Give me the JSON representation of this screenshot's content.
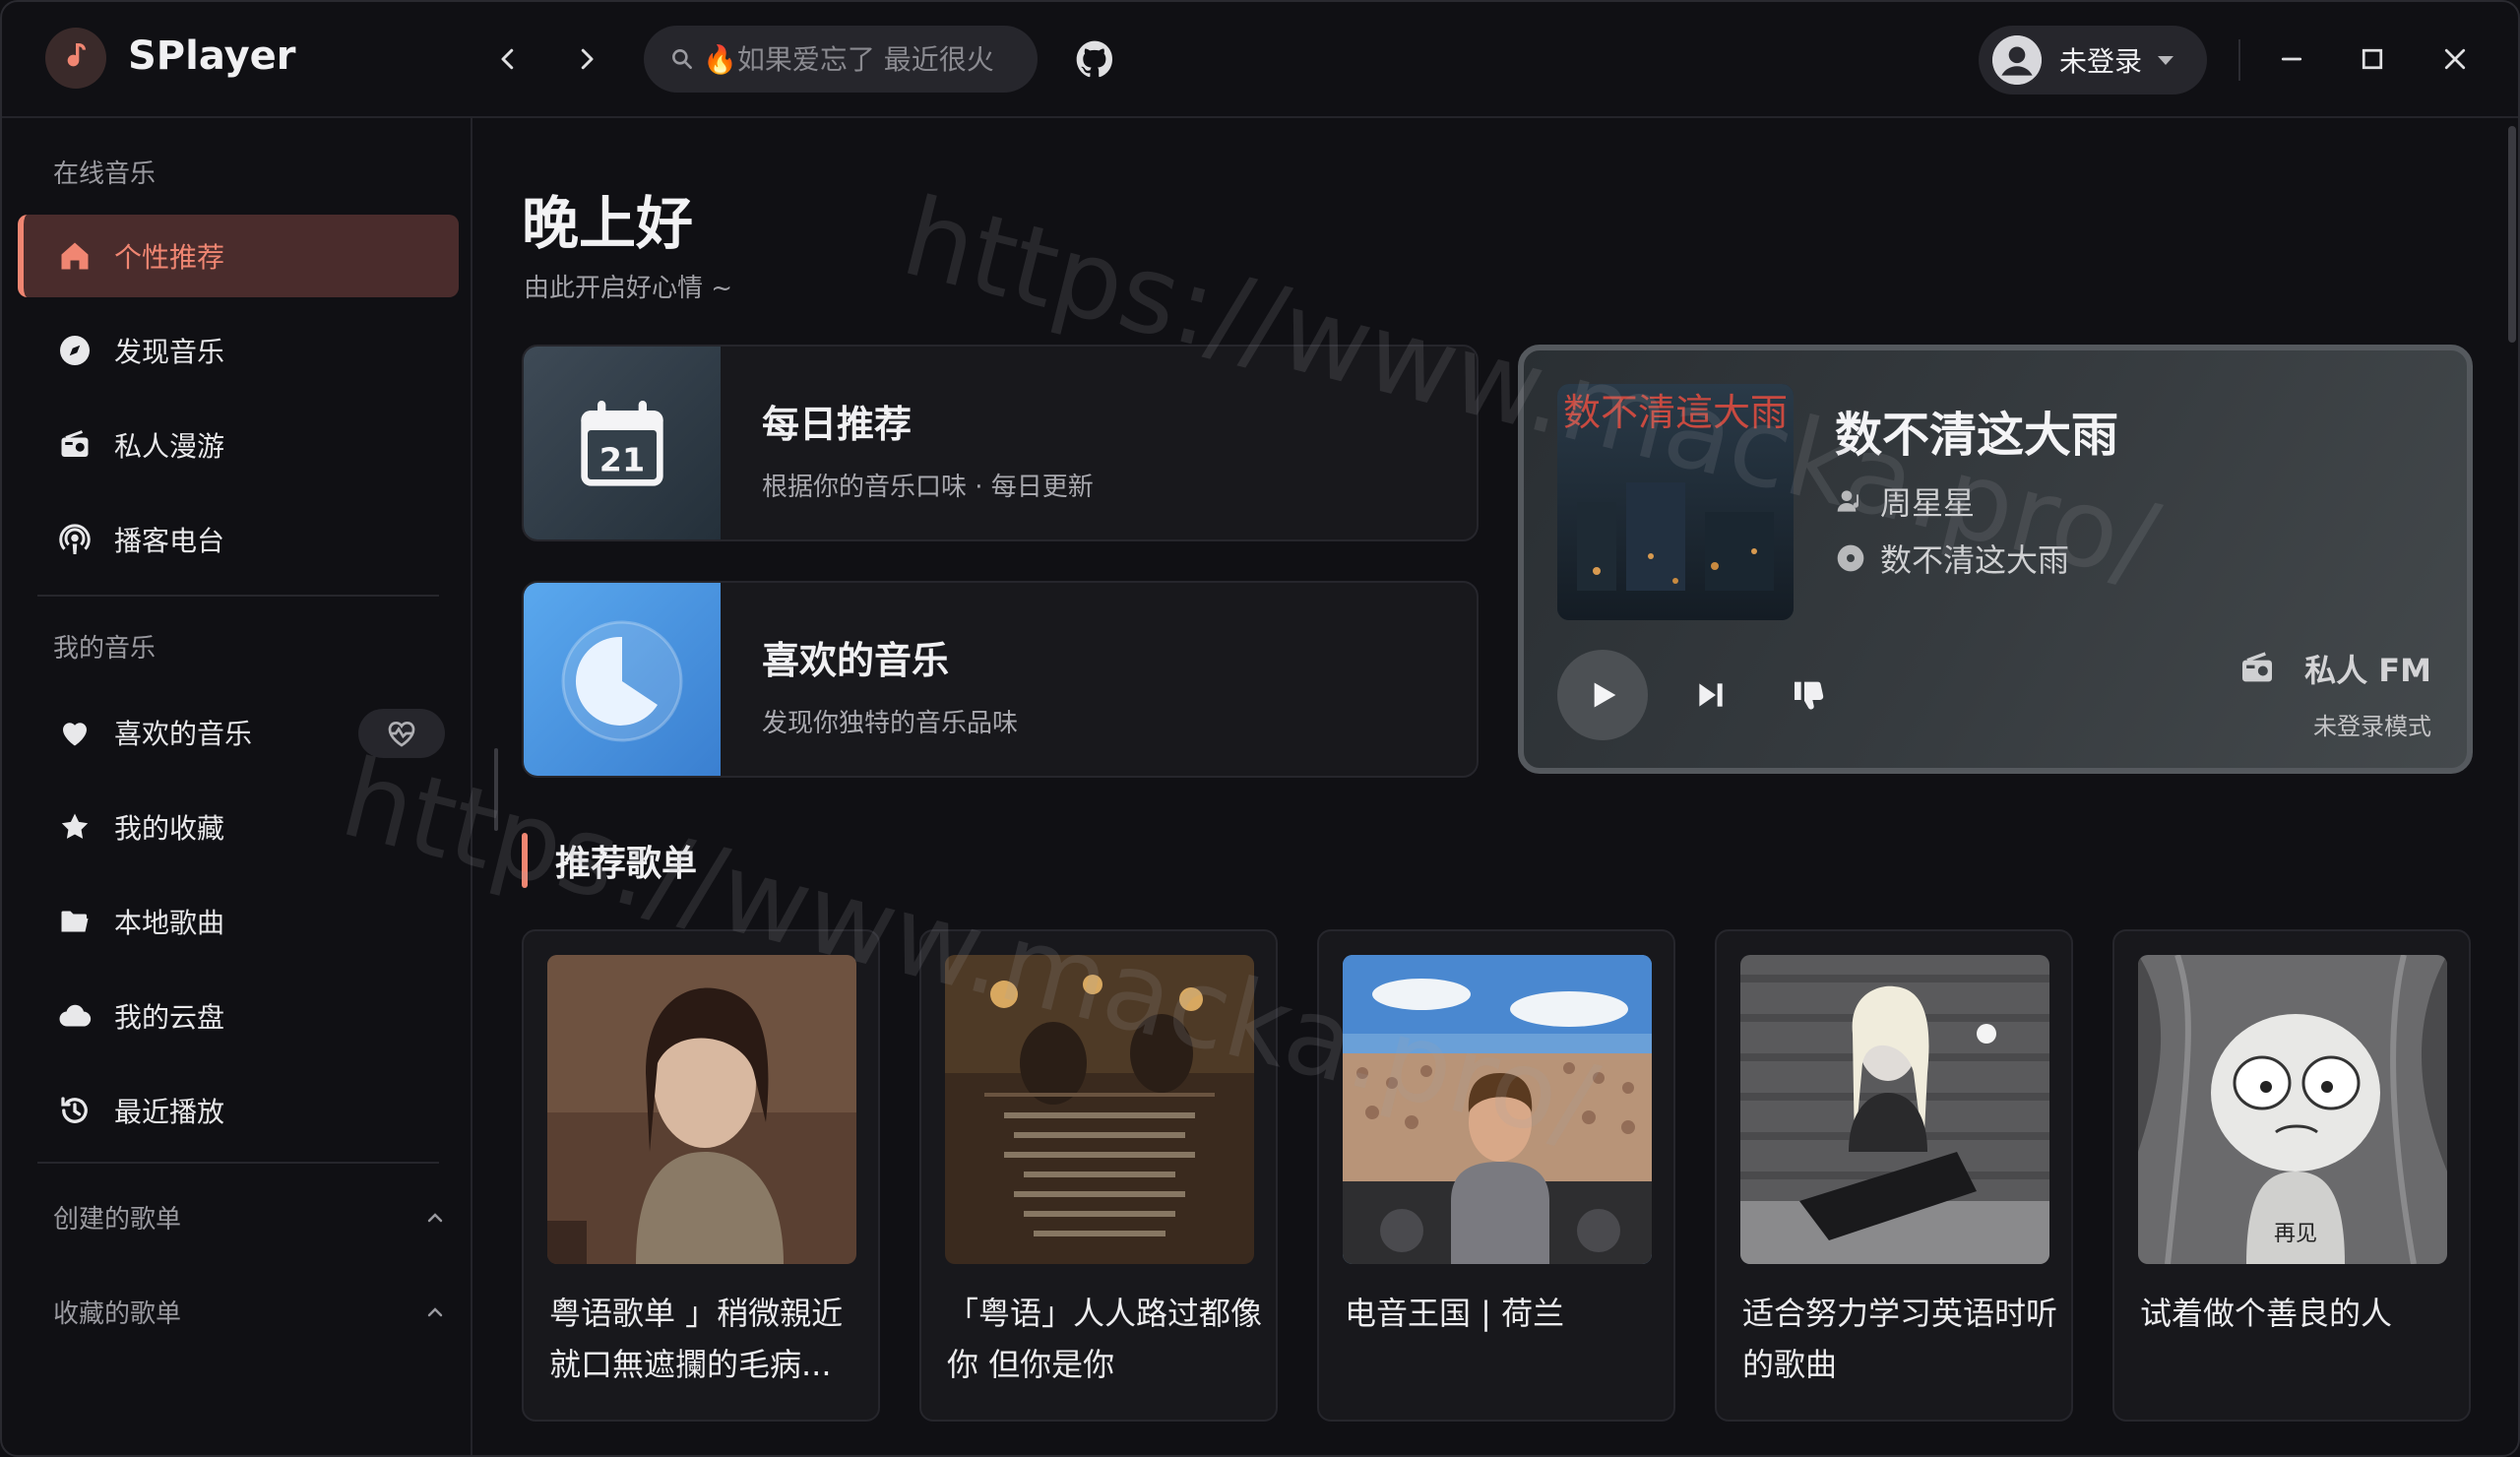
{
  "app": {
    "name": "SPlayer"
  },
  "search": {
    "placeholder": "🔥如果爱忘了 最近很火"
  },
  "user": {
    "name": "未登录"
  },
  "sidebar": {
    "online_title": "在线音乐",
    "online": [
      {
        "label": "个性推荐",
        "icon": "home-icon",
        "active": true
      },
      {
        "label": "发现音乐",
        "icon": "compass-icon"
      },
      {
        "label": "私人漫游",
        "icon": "radio-icon"
      },
      {
        "label": "播客电台",
        "icon": "podcast-icon"
      }
    ],
    "mine_title": "我的音乐",
    "mine": [
      {
        "label": "喜欢的音乐",
        "icon": "heart-icon"
      },
      {
        "label": "我的收藏",
        "icon": "star-icon"
      },
      {
        "label": "本地歌曲",
        "icon": "folder-icon"
      },
      {
        "label": "我的云盘",
        "icon": "cloud-icon"
      },
      {
        "label": "最近播放",
        "icon": "history-icon"
      }
    ],
    "created_title": "创建的歌单",
    "collected_title": "收藏的歌单"
  },
  "main": {
    "greeting": "晚上好",
    "greeting_sub": "由此开启好心情 ~",
    "daily": {
      "title": "每日推荐",
      "subtitle": "根据你的音乐口味 · 每日更新",
      "day": "21"
    },
    "liked": {
      "title": "喜欢的音乐",
      "subtitle": "发现你独特的音乐品味"
    },
    "fm": {
      "song": "数不清这大雨",
      "artist": "周星星",
      "album": "数不清这大雨",
      "label": "私人 FM",
      "mode": "未登录模式",
      "cover_text": "数不清這大雨"
    },
    "section_title": "推荐歌单",
    "playlists": [
      {
        "name": "粤语歌单 」稍微親近就口無遮攔的毛病..."
      },
      {
        "name": "「粤语」人人路过都像你 但你是你"
      },
      {
        "name": "电音王国 | 荷兰"
      },
      {
        "name": "适合努力学习英语时听的歌曲"
      },
      {
        "name": "试着做个善良的人",
        "cover_text": "再见"
      }
    ]
  },
  "watermark": "https://www.macka.pro/",
  "colors": {
    "accent": "#f08672",
    "background": "#101014",
    "card": "#18181c"
  }
}
